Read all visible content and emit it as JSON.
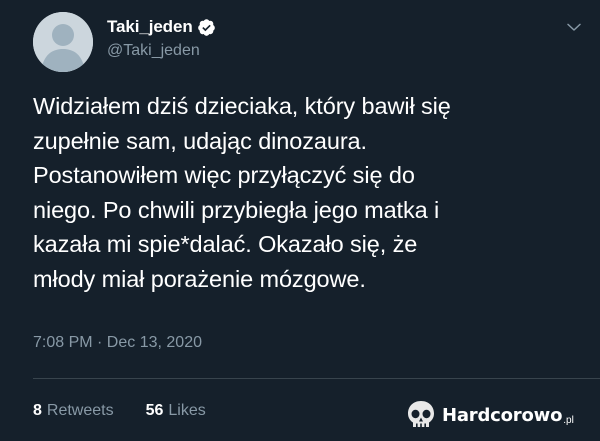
{
  "tweet": {
    "display_name": "Taki_jeden",
    "handle": "@Taki_jeden",
    "verified": true,
    "text": "Widziałem dziś dzieciaka, który bawił się\nzupełnie sam, udając dinozaura.\nPostanowiłem więc przyłączyć się do\nniego. Po chwili przybiegła jego matka i\nkazała mi spie*dalać. Okazało się, że\nmłody miał porażenie mózgowe.",
    "timestamp": "7:08 PM · Dec 13, 2020",
    "stats": {
      "retweets_count": "8",
      "retweets_label": "Retweets",
      "likes_count": "56",
      "likes_label": "Likes"
    }
  },
  "watermark": {
    "brand": "Hardcorowo",
    "tld": ".pl"
  },
  "colors": {
    "background": "#15202b",
    "secondary_text": "#8899a6",
    "verified_badge": "#ffffff",
    "divider": "#38444d"
  },
  "icons": {
    "avatar": "default-avatar-icon",
    "verified": "verified-badge-icon",
    "menu": "chevron-down-icon",
    "watermark": "skull-icon"
  }
}
